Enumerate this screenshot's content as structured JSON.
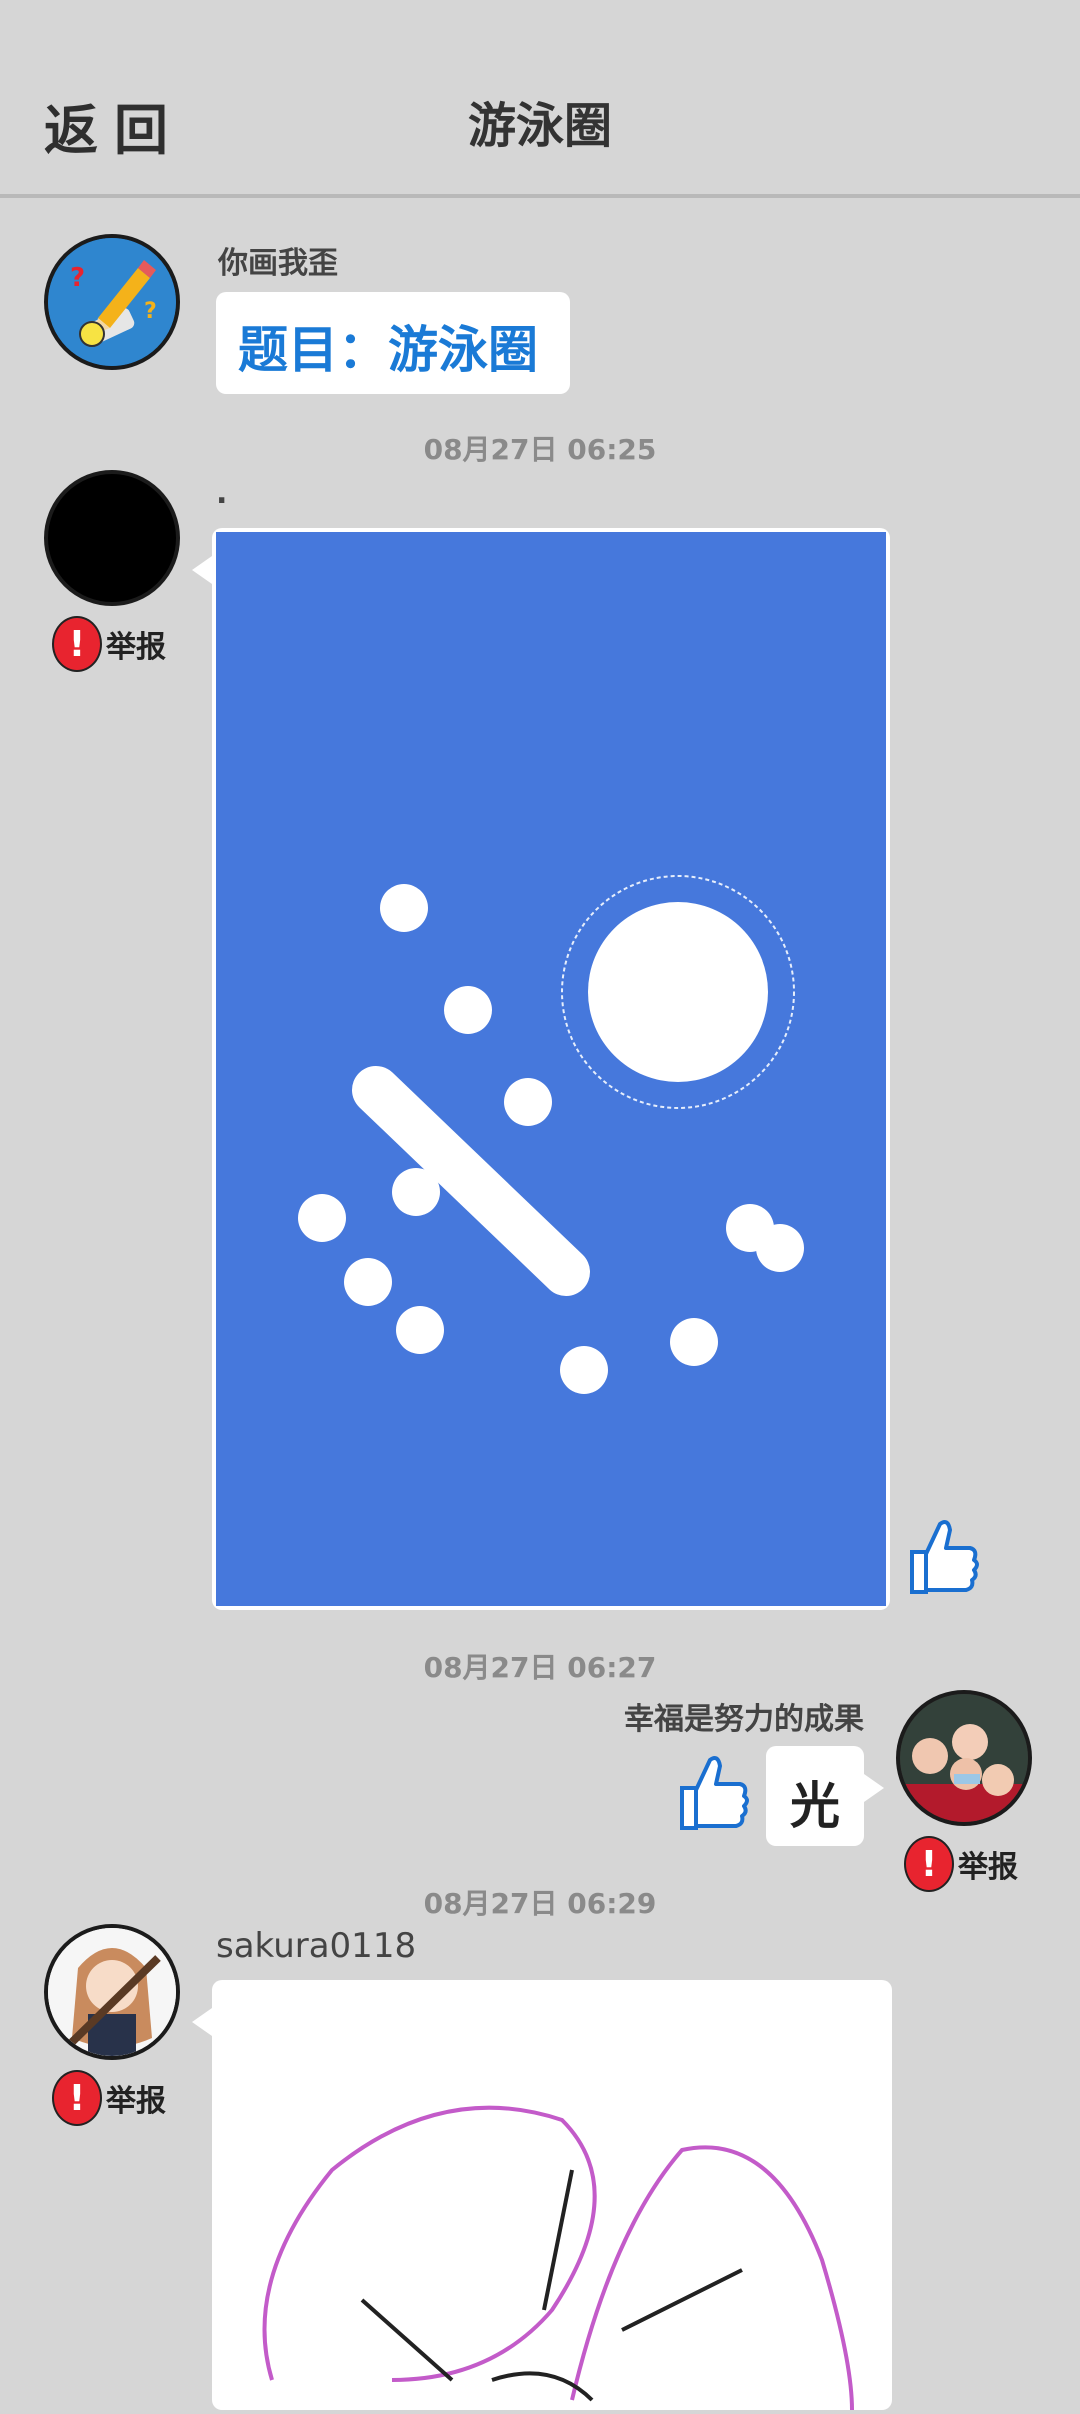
{
  "header": {
    "back_label": "返回",
    "title": "游泳圈"
  },
  "messages": [
    {
      "username": "你画我歪",
      "text": "题目：游泳圈"
    },
    {
      "timestamp": "08月27日  06:25",
      "username": ".",
      "report_label": "举报"
    },
    {
      "timestamp": "08月27日  06:27",
      "username": "幸福是努力的成果",
      "text": "光",
      "report_label": "举报"
    },
    {
      "timestamp": "08月27日  06:29",
      "username": "sakura0118",
      "report_label": "举报"
    }
  ],
  "colors": {
    "accent": "#1a7ad6",
    "drawing_bg": "#4678dc",
    "report_red": "#e8242f",
    "sketch_purple": "#c35bc9"
  },
  "icons": [
    "pencil-game-avatar",
    "thumbs-up-icon",
    "report-icon"
  ]
}
